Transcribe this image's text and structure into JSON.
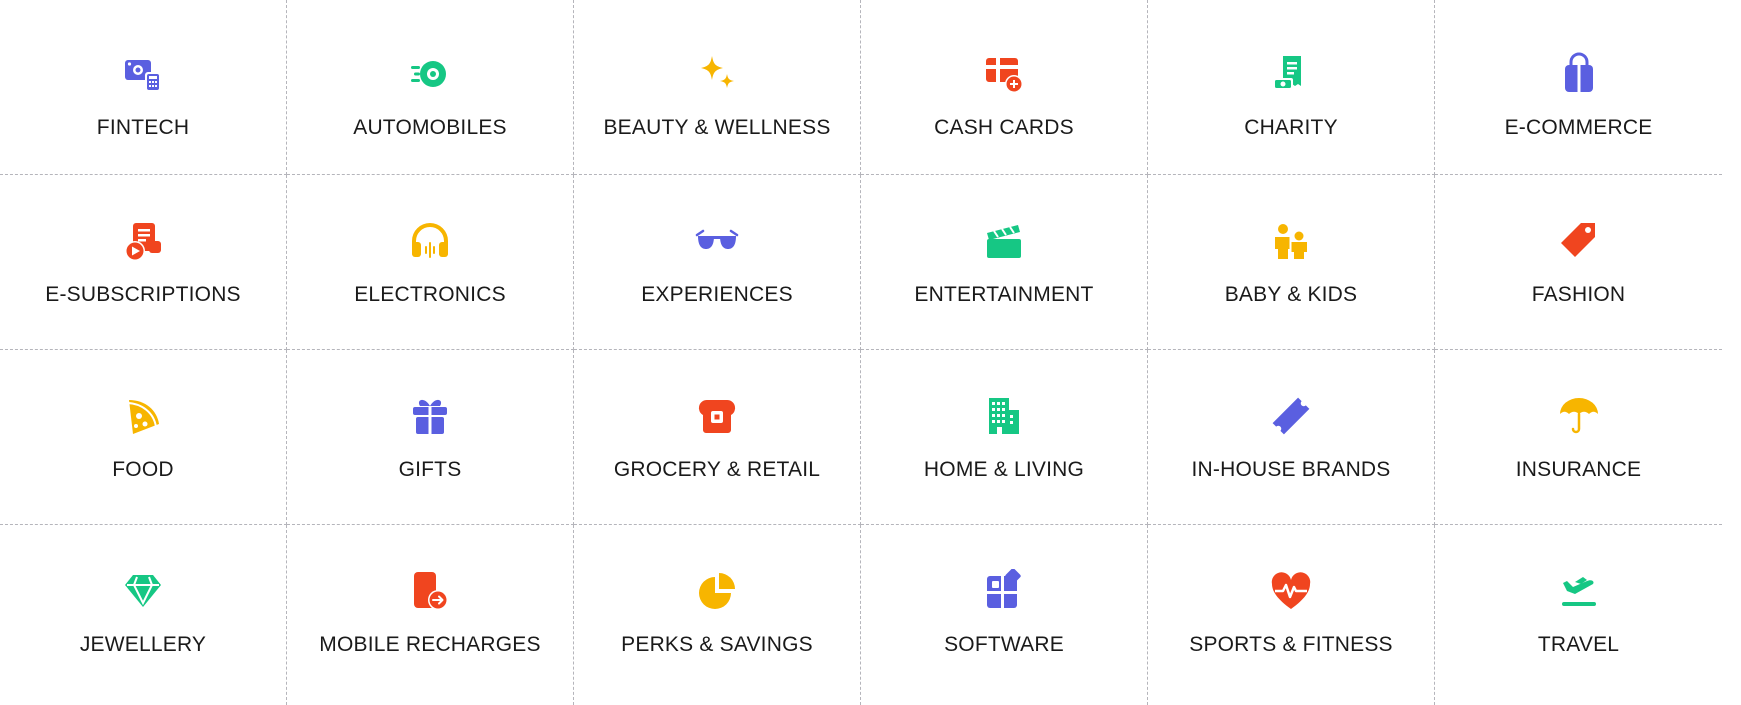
{
  "colors": {
    "blue": "#5a5fe0",
    "green": "#16c784",
    "yellow": "#f7b500",
    "orange": "#f0451f",
    "text": "#1a1a1a",
    "divider": "#b5b5bb"
  },
  "categories": [
    {
      "label": "FINTECH",
      "icon": "money-calculator-icon",
      "color": "blue"
    },
    {
      "label": "AUTOMOBILES",
      "icon": "speeding-wheel-icon",
      "color": "green"
    },
    {
      "label": "BEAUTY & WELLNESS",
      "icon": "sparkles-icon",
      "color": "yellow"
    },
    {
      "label": "CASH CARDS",
      "icon": "card-plus-icon",
      "color": "orange"
    },
    {
      "label": "CHARITY",
      "icon": "donation-receipt-icon",
      "color": "green"
    },
    {
      "label": "E-COMMERCE",
      "icon": "shopping-bag-icon",
      "color": "blue"
    },
    {
      "label": "E-SUBSCRIPTIONS",
      "icon": "subscription-play-icon",
      "color": "orange"
    },
    {
      "label": "ELECTRONICS",
      "icon": "headphones-icon",
      "color": "yellow"
    },
    {
      "label": "EXPERIENCES",
      "icon": "sunglasses-icon",
      "color": "blue"
    },
    {
      "label": "ENTERTAINMENT",
      "icon": "clapperboard-icon",
      "color": "green"
    },
    {
      "label": "BABY & KIDS",
      "icon": "parent-child-icon",
      "color": "yellow"
    },
    {
      "label": "FASHION",
      "icon": "price-tag-icon",
      "color": "orange"
    },
    {
      "label": "FOOD",
      "icon": "pizza-slice-icon",
      "color": "yellow"
    },
    {
      "label": "GIFTS",
      "icon": "gift-box-icon",
      "color": "blue"
    },
    {
      "label": "GROCERY & RETAIL",
      "icon": "bread-toast-icon",
      "color": "orange"
    },
    {
      "label": "HOME & LIVING",
      "icon": "building-icon",
      "color": "green"
    },
    {
      "label": "IN-HOUSE BRANDS",
      "icon": "ticket-icon",
      "color": "blue"
    },
    {
      "label": "INSURANCE",
      "icon": "umbrella-icon",
      "color": "yellow"
    },
    {
      "label": "JEWELLERY",
      "icon": "diamond-icon",
      "color": "green"
    },
    {
      "label": "MOBILE RECHARGES",
      "icon": "phone-arrow-icon",
      "color": "orange"
    },
    {
      "label": "PERKS & SAVINGS",
      "icon": "pie-chart-icon",
      "color": "yellow"
    },
    {
      "label": "SOFTWARE",
      "icon": "app-blocks-icon",
      "color": "blue"
    },
    {
      "label": "SPORTS & FITNESS",
      "icon": "heartbeat-icon",
      "color": "orange"
    },
    {
      "label": "TRAVEL",
      "icon": "airplane-icon",
      "color": "green"
    }
  ]
}
